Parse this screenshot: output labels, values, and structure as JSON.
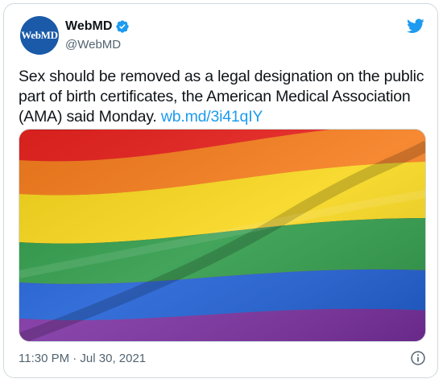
{
  "account": {
    "avatar_text": "WebMD",
    "display_name": "WebMD",
    "handle": "@WebMD",
    "verified": true
  },
  "tweet": {
    "text": "Sex should be removed as a legal designation on the public part of birth certificates, the American Medical Association (AMA) said Monday. ",
    "link": "wb.md/3i41qIY",
    "timestamp": "11:30 PM · Jul 30, 2021"
  },
  "media": {
    "description_icon": "rainbow-pride-flag-image",
    "stripe_colors": [
      "#e8231f",
      "#f57c1c",
      "#f7d61b",
      "#2e9a48",
      "#1f5fd4",
      "#7a2fa0"
    ]
  },
  "icons": {
    "brand": "twitter-bird-icon",
    "verified": "verified-badge-icon",
    "info": "info-icon"
  },
  "colors": {
    "accent": "#1d9bf0",
    "text": "#0f1419",
    "muted": "#536471",
    "avatar_bg": "#1a5aa8"
  }
}
